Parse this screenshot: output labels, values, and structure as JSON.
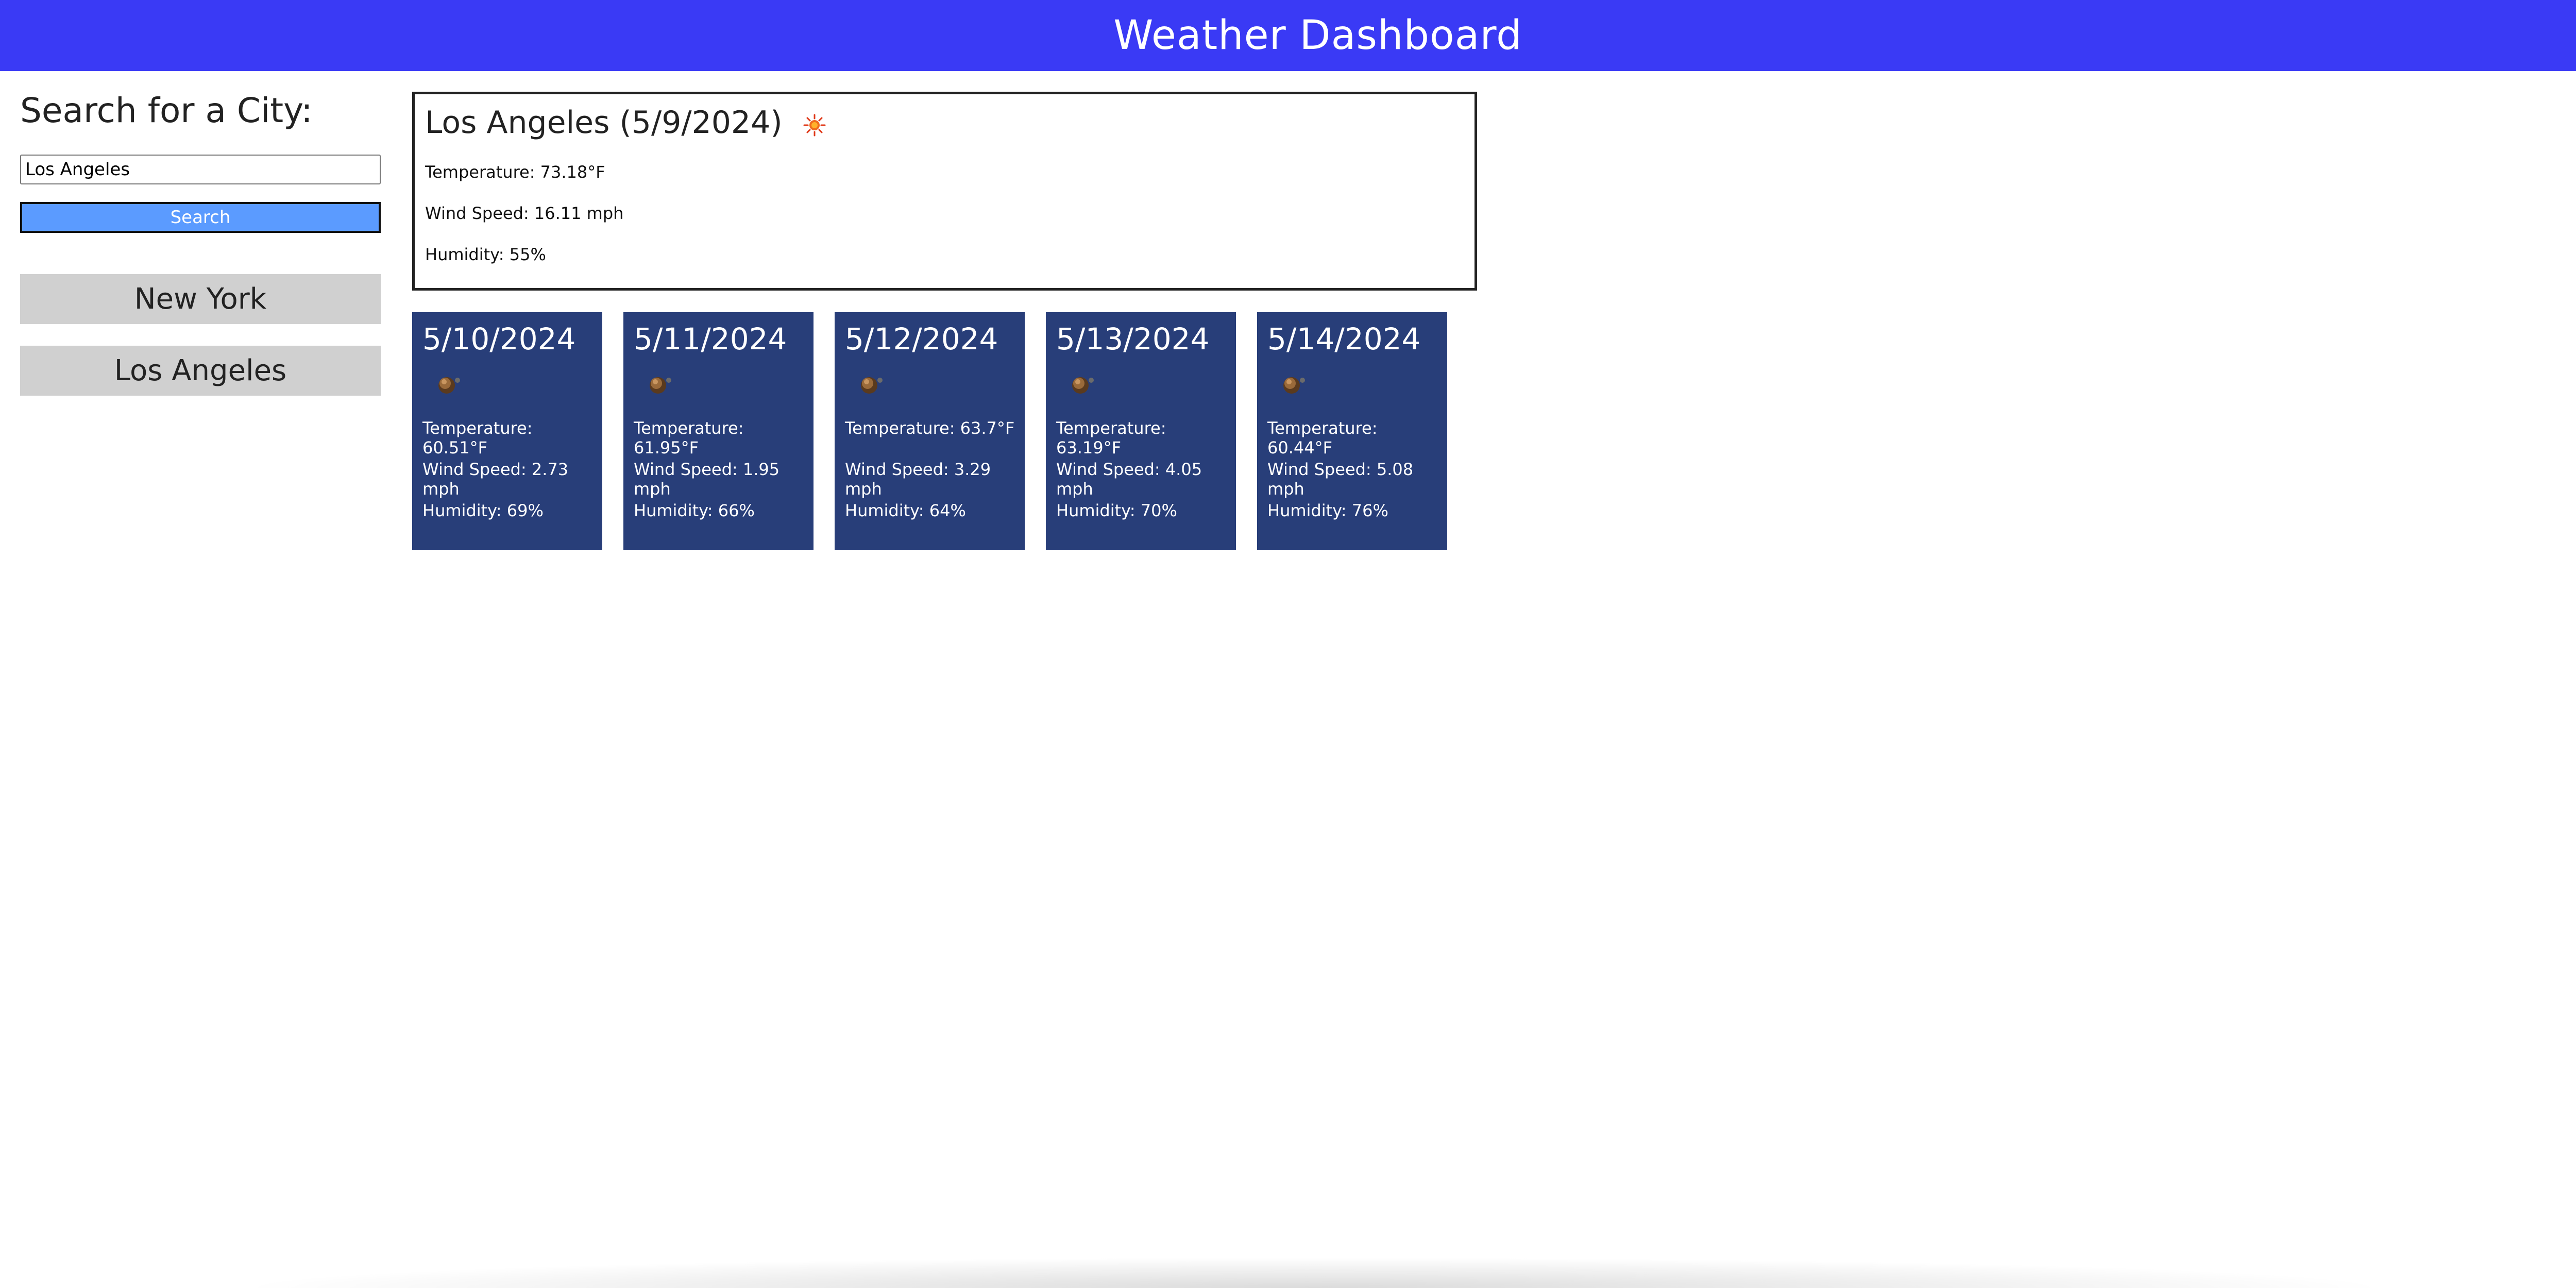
{
  "header": {
    "title": "Weather Dashboard",
    "background_color": "#3a3af5"
  },
  "sidebar": {
    "heading": "Search for a City:",
    "search": {
      "value": "Los Angeles",
      "button_label": "Search",
      "button_color": "#5b9bff"
    },
    "history": [
      {
        "label": "New York"
      },
      {
        "label": "Los Angeles"
      }
    ]
  },
  "current": {
    "title": "Los Angeles (5/9/2024)",
    "icon": "sun-icon",
    "temperature": "Temperature: 73.18°F",
    "wind": "Wind Speed: 16.11 mph",
    "humidity": "Humidity: 55%"
  },
  "forecast": {
    "card_color": "#283e79",
    "days": [
      {
        "date": "5/10/2024",
        "icon": "moon-icon",
        "temperature": "Temperature: 60.51°F",
        "wind": "Wind Speed: 2.73 mph",
        "humidity": "Humidity: 69%"
      },
      {
        "date": "5/11/2024",
        "icon": "moon-icon",
        "temperature": "Temperature: 61.95°F",
        "wind": "Wind Speed: 1.95 mph",
        "humidity": "Humidity: 66%"
      },
      {
        "date": "5/12/2024",
        "icon": "moon-icon",
        "temperature": "Temperature: 63.7°F",
        "wind": "Wind Speed: 3.29 mph",
        "humidity": "Humidity: 64%"
      },
      {
        "date": "5/13/2024",
        "icon": "moon-icon",
        "temperature": "Temperature: 63.19°F",
        "wind": "Wind Speed: 4.05 mph",
        "humidity": "Humidity: 70%"
      },
      {
        "date": "5/14/2024",
        "icon": "moon-icon",
        "temperature": "Temperature: 60.44°F",
        "wind": "Wind Speed: 5.08 mph",
        "humidity": "Humidity: 76%"
      }
    ]
  }
}
